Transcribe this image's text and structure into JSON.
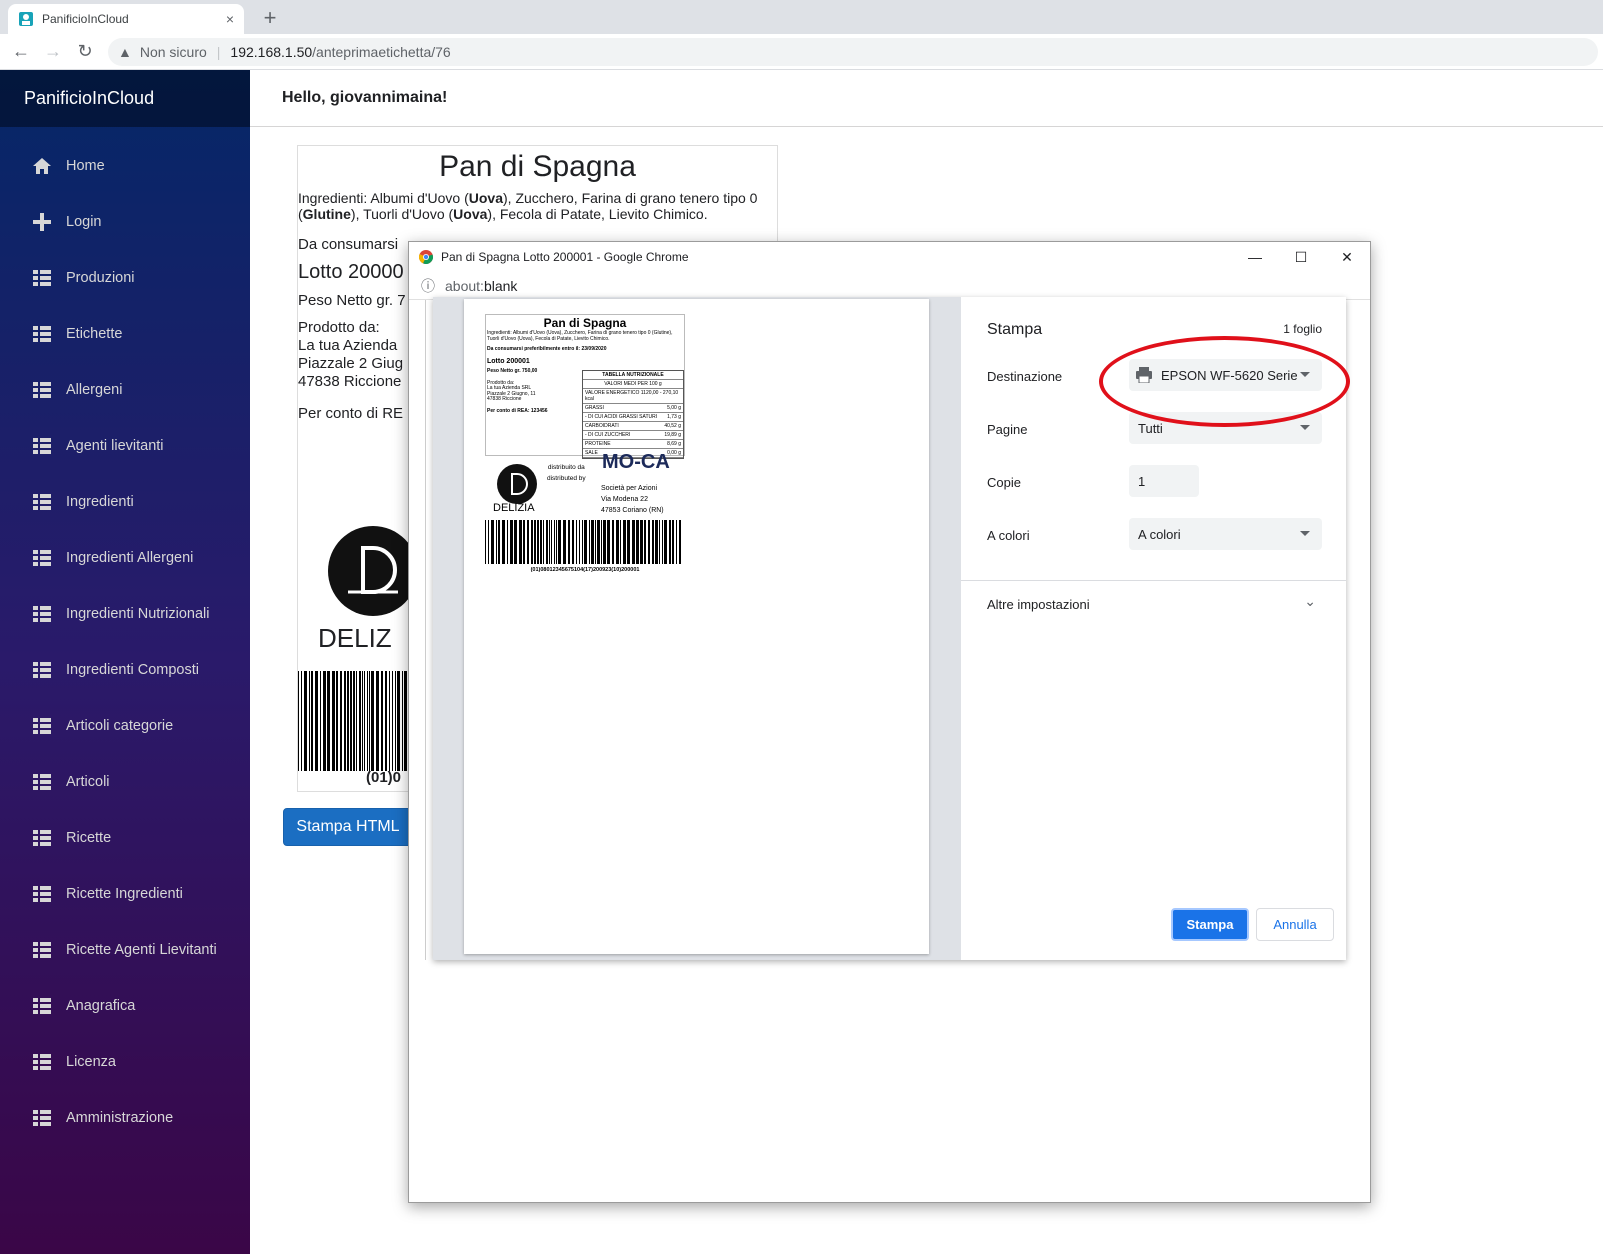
{
  "browser": {
    "tab_title": "PanificioInCloud",
    "close_tab": "×",
    "new_tab": "+",
    "security_label": "Non sicuro",
    "url_host": "192.168.1.50",
    "url_path": "/anteprimaetichetta/76"
  },
  "app": {
    "brand": "PanificioInCloud",
    "greeting": "Hello, giovannimaina!",
    "menu": [
      {
        "label": "Home",
        "icon": "home-icon"
      },
      {
        "label": "Login",
        "icon": "plus-icon"
      },
      {
        "label": "Produzioni",
        "icon": "list-icon"
      },
      {
        "label": "Etichette",
        "icon": "list-icon"
      },
      {
        "label": "Allergeni",
        "icon": "list-icon"
      },
      {
        "label": "Agenti lievitanti",
        "icon": "list-icon"
      },
      {
        "label": "Ingredienti",
        "icon": "list-icon"
      },
      {
        "label": "Ingredienti Allergeni",
        "icon": "list-icon"
      },
      {
        "label": "Ingredienti Nutrizionali",
        "icon": "list-icon"
      },
      {
        "label": "Ingredienti Composti",
        "icon": "list-icon"
      },
      {
        "label": "Articoli categorie",
        "icon": "list-icon"
      },
      {
        "label": "Articoli",
        "icon": "list-icon"
      },
      {
        "label": "Ricette",
        "icon": "list-icon"
      },
      {
        "label": "Ricette Ingredienti",
        "icon": "list-icon"
      },
      {
        "label": "Ricette Agenti Lievitanti",
        "icon": "list-icon"
      },
      {
        "label": "Anagrafica",
        "icon": "list-icon"
      },
      {
        "label": "Licenza",
        "icon": "list-icon"
      },
      {
        "label": "Amministrazione",
        "icon": "list-icon"
      }
    ],
    "stampa_html": "Stampa HTML"
  },
  "label": {
    "title": "Pan di Spagna",
    "ingredients_prefix": "Ingredienti: Albumi d'Uovo (",
    "allergen_1": "Uova",
    "ingredients_mid1": "), Zucchero, Farina di grano tenero tipo 0 (",
    "allergen_2": "Glutine",
    "ingredients_mid2": "), Tuorli d'Uovo (",
    "allergen_3": "Uova",
    "ingredients_end": "), Fecola di Patate, Lievito Chimico.",
    "consumarsi": "Da consumarsi",
    "lotto": "Lotto 20000",
    "peso": "Peso Netto gr. 7",
    "prodotto_da": "Prodotto da:",
    "azienda": "La tua Azienda",
    "indirizzo": "Piazzale 2 Giug",
    "citta": "47838 Riccione",
    "conto": "Per conto di RE",
    "logo_text": "DELIZ",
    "barcode_text": "(01)0"
  },
  "popup": {
    "window_title": "Pan di Spagna Lotto 200001 - Google Chrome",
    "address_prefix": "about:",
    "address_page": "blank"
  },
  "print": {
    "title": "Stampa",
    "sheets": "1 foglio",
    "dest_label": "Destinazione",
    "dest_value": "EPSON WF-5620 Serie",
    "pages_label": "Pagine",
    "pages_value": "Tutti",
    "copies_label": "Copie",
    "copies_value": "1",
    "color_label": "A colori",
    "color_value": "A colori",
    "more_settings": "Altre impostazioni",
    "print_button": "Stampa",
    "cancel_button": "Annulla"
  },
  "preview": {
    "title": "Pan di Spagna",
    "ingredients": "Ingredienti: Albumi d'Uovo (Uova), Zucchero, Farina di grano tenero tipo 0 (Glutine), Tuorli d'Uovo (Uova), Fecola di Patate, Lievito Chimico.",
    "consumarsi": "Da consumarsi preferibilmente entro il: 23/09/2020",
    "lotto": "Lotto 200001",
    "peso": "Peso Netto gr. 750,00",
    "prodotto": [
      "Prodotto da:",
      "La tua Azienda SRL",
      "Piazzale 2 Giugno, 11",
      "47838 Riccione"
    ],
    "conto": "Per conto di REA: 123456",
    "table": {
      "header": "TABELLA NUTRIZIONALE",
      "sub": "VALORI MEDI PER 100 g",
      "rows": [
        {
          "k": "VALORE ENERGETICO 1120,00 - 270,10 kcal",
          "v": ""
        },
        {
          "k": "GRASSI",
          "v": "5,00 g"
        },
        {
          "k": "- DI CUI ACIDI GRASSI SATURI",
          "v": "1,73 g"
        },
        {
          "k": "CARBOIDRATI",
          "v": "40,52 g"
        },
        {
          "k": "- DI CUI ZUCCHERI",
          "v": "19,89 g"
        },
        {
          "k": "PROTEINE",
          "v": "8,69 g"
        },
        {
          "k": "SALE",
          "v": "0,00 g"
        }
      ]
    },
    "distributed": [
      "distribuito da",
      "distributed by"
    ],
    "logo_left": "DELIZIA",
    "logo_right": "MO-CA",
    "company": [
      "Società per Azioni",
      "Via Modena 22",
      "47853 Coriano (RN)"
    ],
    "barcode": "(01)08012345675104(17)200923(10)200001"
  },
  "colors": {
    "accent": "#1a73e8",
    "app_button": "#1b6ec2",
    "highlight_ring": "#e0101a",
    "sidebar_top": "#052767",
    "sidebar_bottom": "#3a0647"
  }
}
